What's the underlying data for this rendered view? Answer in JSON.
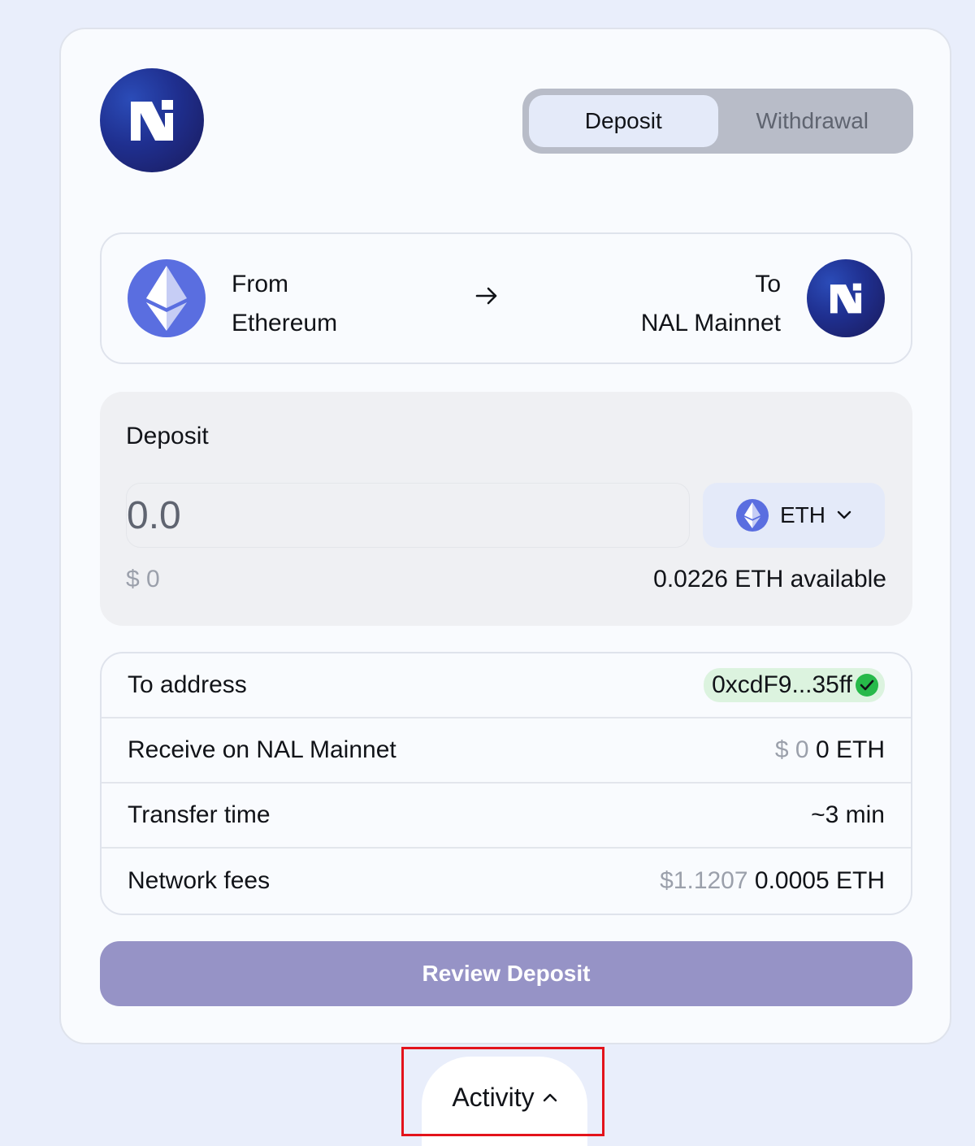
{
  "header": {
    "logo_icon": "nal-logo-icon",
    "tabs": [
      {
        "label": "Deposit",
        "active": true
      },
      {
        "label": "Withdrawal",
        "active": false
      }
    ]
  },
  "route": {
    "from_label": "From",
    "from_network": "Ethereum",
    "from_icon": "ethereum-icon",
    "arrow_icon": "arrow-right-icon",
    "to_label": "To",
    "to_network": "NAL Mainnet",
    "to_icon": "nal-logo-icon"
  },
  "amount": {
    "label": "Deposit",
    "placeholder": "0.0",
    "token": "ETH",
    "usd_value": "$ 0",
    "available": "0.0226 ETH available"
  },
  "details": {
    "to_address_label": "To address",
    "to_address_value": "0xcdF9...35ff",
    "receive_label": "Receive on NAL Mainnet",
    "receive_usd": "$ 0",
    "receive_amount": "0 ETH",
    "transfer_time_label": "Transfer time",
    "transfer_time_value": "~3 min",
    "fees_label": "Network fees",
    "fees_usd": "$1.1207",
    "fees_amount": "0.0005 ETH"
  },
  "actions": {
    "review_label": "Review Deposit",
    "activity_label": "Activity"
  },
  "colors": {
    "accent_button": "#9693c6",
    "ethereum": "#5a6ee0",
    "verified": "#27b94a",
    "highlight": "#e3131b"
  }
}
